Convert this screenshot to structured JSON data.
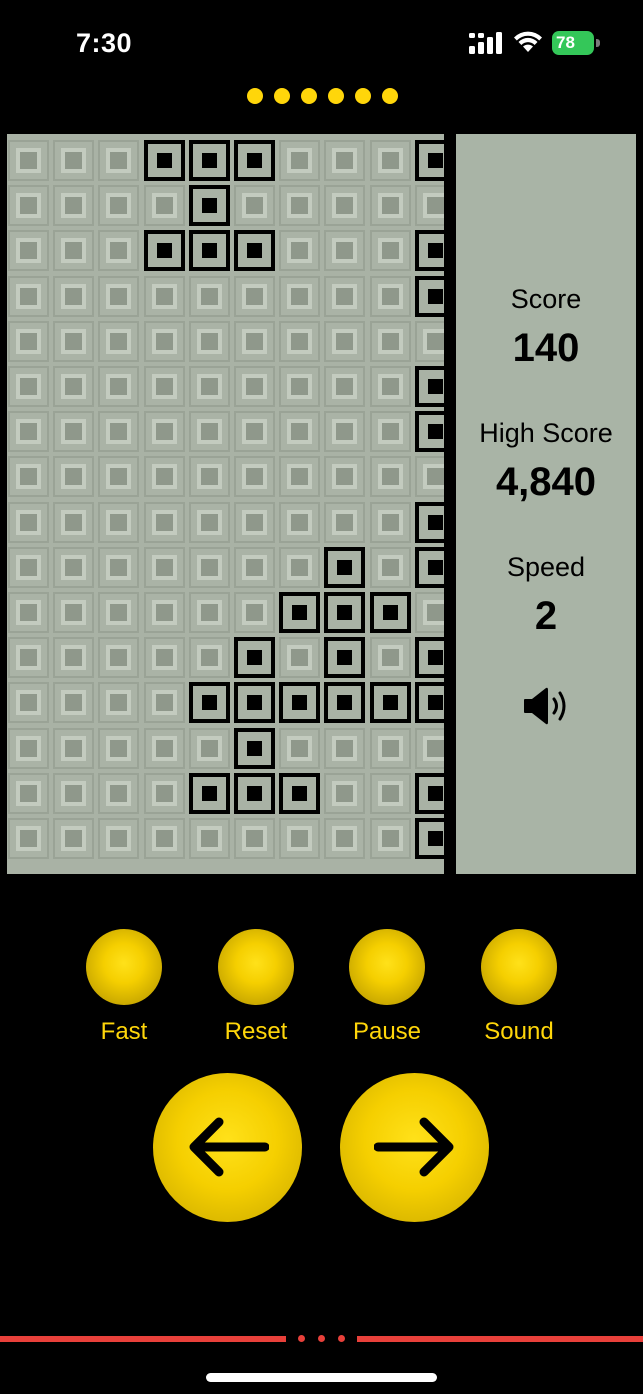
{
  "status_bar": {
    "time": "7:30",
    "battery": "78",
    "icons": [
      "signal-icon",
      "wifi-icon",
      "battery-icon"
    ]
  },
  "page_indicator": {
    "count": 6,
    "color": "#ffd60a"
  },
  "board": {
    "columns": 10,
    "rows": 16,
    "filled_cells": [
      [
        0,
        3
      ],
      [
        0,
        4
      ],
      [
        0,
        5
      ],
      [
        0,
        9
      ],
      [
        1,
        4
      ],
      [
        2,
        3
      ],
      [
        2,
        4
      ],
      [
        2,
        5
      ],
      [
        2,
        9
      ],
      [
        3,
        9
      ],
      [
        5,
        9
      ],
      [
        6,
        9
      ],
      [
        8,
        9
      ],
      [
        9,
        7
      ],
      [
        9,
        9
      ],
      [
        10,
        6
      ],
      [
        10,
        7
      ],
      [
        10,
        8
      ],
      [
        11,
        5
      ],
      [
        11,
        7
      ],
      [
        11,
        9
      ],
      [
        12,
        4
      ],
      [
        12,
        5
      ],
      [
        12,
        6
      ],
      [
        12,
        7
      ],
      [
        12,
        8
      ],
      [
        12,
        9
      ],
      [
        13,
        5
      ],
      [
        14,
        4
      ],
      [
        14,
        5
      ],
      [
        14,
        6
      ],
      [
        14,
        9
      ],
      [
        15,
        9
      ]
    ]
  },
  "panel": {
    "score_label": "Score",
    "score_value": "140",
    "high_score_label": "High Score",
    "high_score_value": "4,840",
    "speed_label": "Speed",
    "speed_value": "2",
    "sound_icon": "speaker-icon"
  },
  "controls": {
    "fast_label": "Fast",
    "reset_label": "Reset",
    "pause_label": "Pause",
    "sound_label": "Sound",
    "left_icon": "arrow-left-icon",
    "right_icon": "arrow-right-icon"
  },
  "colors": {
    "accent": "#ffd60a",
    "board_bg": "#a9b2a5",
    "panel_bg": "#a9b4a6",
    "bottom_bar": "#e8403a",
    "battery": "#34c759"
  }
}
